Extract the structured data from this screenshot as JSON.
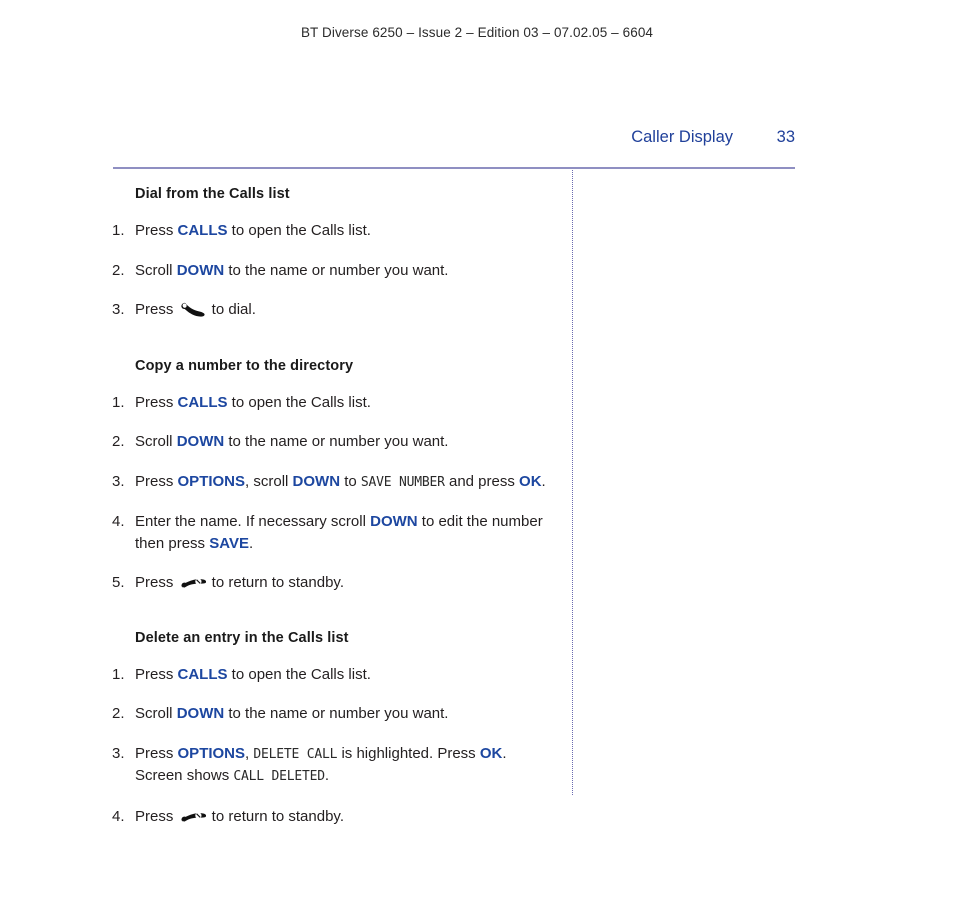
{
  "header": {
    "running_head": "BT Diverse 6250 – Issue 2 – Edition 03 – 07.02.05 – 6604"
  },
  "page": {
    "chapter_title": "Caller Display",
    "page_number": "33",
    "accent_color": "#20409a",
    "rule_color": "#8f8fc2",
    "divider_color": "#6a6ab0"
  },
  "sections": [
    {
      "heading": "Dial from the Calls list",
      "steps": [
        {
          "num": "1.",
          "parts": [
            {
              "t": "text",
              "v": "Press "
            },
            {
              "t": "kw",
              "v": "CALLS"
            },
            {
              "t": "text",
              "v": " to open the Calls list."
            }
          ]
        },
        {
          "num": "2.",
          "parts": [
            {
              "t": "text",
              "v": "Scroll "
            },
            {
              "t": "kw",
              "v": "DOWN"
            },
            {
              "t": "text",
              "v": " to the name or number you want."
            }
          ]
        },
        {
          "num": "3.",
          "parts": [
            {
              "t": "text",
              "v": "Press "
            },
            {
              "t": "icon",
              "v": "handset-call-icon"
            },
            {
              "t": "text",
              "v": " to dial."
            }
          ]
        }
      ]
    },
    {
      "heading": "Copy a number to the directory",
      "steps": [
        {
          "num": "1.",
          "parts": [
            {
              "t": "text",
              "v": "Press "
            },
            {
              "t": "kw",
              "v": "CALLS"
            },
            {
              "t": "text",
              "v": " to open the Calls list."
            }
          ]
        },
        {
          "num": "2.",
          "parts": [
            {
              "t": "text",
              "v": "Scroll "
            },
            {
              "t": "kw",
              "v": "DOWN"
            },
            {
              "t": "text",
              "v": " to the name or number you want."
            }
          ]
        },
        {
          "num": "3.",
          "parts": [
            {
              "t": "text",
              "v": "Press "
            },
            {
              "t": "kw",
              "v": "OPTIONS"
            },
            {
              "t": "text",
              "v": ", scroll "
            },
            {
              "t": "kw",
              "v": "DOWN"
            },
            {
              "t": "text",
              "v": " to "
            },
            {
              "t": "lcd",
              "v": "SAVE NUMBER"
            },
            {
              "t": "text",
              "v": " and press "
            },
            {
              "t": "kw",
              "v": "OK"
            },
            {
              "t": "text",
              "v": "."
            }
          ]
        },
        {
          "num": "4.",
          "parts": [
            {
              "t": "text",
              "v": "Enter the name. If necessary scroll "
            },
            {
              "t": "kw",
              "v": "DOWN"
            },
            {
              "t": "text",
              "v": " to edit the number then press "
            },
            {
              "t": "kw",
              "v": "SAVE"
            },
            {
              "t": "text",
              "v": "."
            }
          ]
        },
        {
          "num": "5.",
          "parts": [
            {
              "t": "text",
              "v": "Press "
            },
            {
              "t": "icon",
              "v": "handset-end-icon"
            },
            {
              "t": "text",
              "v": " to return to standby."
            }
          ]
        }
      ]
    },
    {
      "heading": "Delete an entry in the Calls list",
      "steps": [
        {
          "num": "1.",
          "parts": [
            {
              "t": "text",
              "v": "Press "
            },
            {
              "t": "kw",
              "v": "CALLS"
            },
            {
              "t": "text",
              "v": " to open the Calls list."
            }
          ]
        },
        {
          "num": "2.",
          "parts": [
            {
              "t": "text",
              "v": "Scroll "
            },
            {
              "t": "kw",
              "v": "DOWN"
            },
            {
              "t": "text",
              "v": " to the name or number you want."
            }
          ]
        },
        {
          "num": "3.",
          "parts": [
            {
              "t": "text",
              "v": "Press "
            },
            {
              "t": "kw",
              "v": "OPTIONS"
            },
            {
              "t": "text",
              "v": ", "
            },
            {
              "t": "lcd",
              "v": "DELETE CALL"
            },
            {
              "t": "text",
              "v": " is highlighted. Press "
            },
            {
              "t": "kw",
              "v": "OK"
            },
            {
              "t": "text",
              "v": ". Screen shows "
            },
            {
              "t": "lcd",
              "v": "CALL DELETED"
            },
            {
              "t": "text",
              "v": "."
            }
          ]
        },
        {
          "num": "4.",
          "parts": [
            {
              "t": "text",
              "v": "Press "
            },
            {
              "t": "icon",
              "v": "handset-end-icon"
            },
            {
              "t": "text",
              "v": " to return to standby."
            }
          ]
        }
      ]
    }
  ]
}
